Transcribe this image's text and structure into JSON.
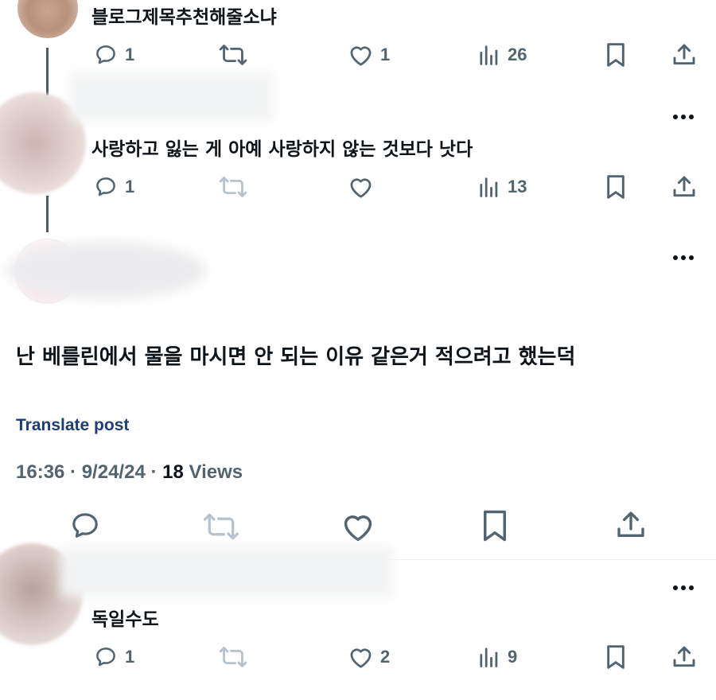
{
  "reply_top": {
    "text": "블로그제목추천해줄소냐",
    "replies": "1",
    "likes": "1",
    "views": "26"
  },
  "reply_second": {
    "text": "사랑하고 잃는 게 아예 사랑하지 않는 것보다 낫다",
    "replies": "1",
    "views": "13"
  },
  "main_post": {
    "text": "난 베를린에서 물을 마시면 안 되는 이유 같은거 적으려고 했는덕",
    "translate_label": "Translate post",
    "timestamp": "16:36 · 9/24/24 · ",
    "views_count": "18",
    "views_label": " Views"
  },
  "reply_bottom": {
    "text": "독일수도",
    "replies": "1",
    "likes": "2",
    "views": "9"
  },
  "icons": {
    "reply": "speech-bubble-icon",
    "repost": "repost-arrows-icon",
    "like": "heart-icon",
    "views": "bar-chart-icon",
    "bookmark": "bookmark-icon",
    "share": "share-upload-icon",
    "more": "more-dots-icon"
  },
  "colors": {
    "text_primary": "#0f1419",
    "text_secondary": "#536471",
    "icon_disabled": "#b8c2cc",
    "translate_link": "#1d3d78"
  }
}
